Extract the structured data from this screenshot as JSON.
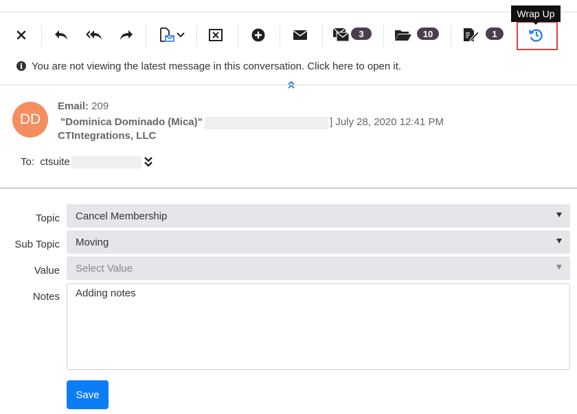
{
  "toolbar": {
    "badges": {
      "conversation_count": "3",
      "folder_count": "10",
      "draft_count": "1"
    },
    "tooltip": "Wrap Up"
  },
  "info_banner": {
    "text": "You are not viewing the latest message in this conversation. Click here to open it."
  },
  "email": {
    "avatar_initials": "DD",
    "label": "Email:",
    "id": "209",
    "from_name": "\"Dominica Dominado (Mica)\" [",
    "date_prefix": "]",
    "date": "July 28, 2020 12:41 PM",
    "company": "CTIntegrations, LLC",
    "to_label": "To:",
    "to_value": "ctsuite"
  },
  "form": {
    "topic_label": "Topic",
    "topic_value": "Cancel Membership",
    "subtopic_label": "Sub Topic",
    "subtopic_value": "Moving",
    "value_label": "Value",
    "value_placeholder": "Select Value",
    "notes_label": "Notes",
    "notes_value": "Adding notes",
    "save_label": "Save"
  },
  "colors": {
    "accent": "#0d7df5",
    "avatar": "#f68d5f",
    "badge": "#4b3f4f",
    "highlight": "#d9423c",
    "field_bg": "#e4e6ea"
  }
}
